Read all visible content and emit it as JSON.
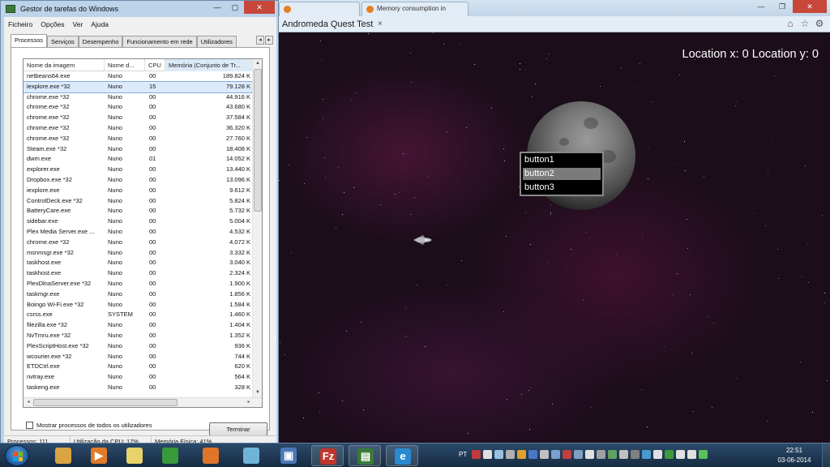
{
  "browser": {
    "tabs": [
      {
        "label": "",
        "icon": "page-icon"
      },
      {
        "label": "Memory consumption in",
        "icon": "page-icon"
      }
    ],
    "page_title": "Andromeda Quest Test",
    "tab_close": "×",
    "tools": [
      "home-icon",
      "star-icon",
      "gear-icon"
    ],
    "win_controls": {
      "minimize": "—",
      "maximize": "❐",
      "close": "✕"
    }
  },
  "game": {
    "location_text": "Location x: 0 Location y: 0",
    "menu_buttons": [
      {
        "label": "button1",
        "selected": false
      },
      {
        "label": "button2",
        "selected": true
      },
      {
        "label": "button3",
        "selected": false
      }
    ]
  },
  "taskmanager": {
    "title": "Gestor de tarefas do Windows",
    "win_controls": {
      "minimize": "—",
      "maximize": "▢",
      "close": "✕"
    },
    "menu": [
      "Ficheiro",
      "Opções",
      "Ver",
      "Ajuda"
    ],
    "tabs": [
      {
        "label": "Processos",
        "active": true
      },
      {
        "label": "Serviços",
        "active": false
      },
      {
        "label": "Desempenho",
        "active": false
      },
      {
        "label": "Funcionamento em rede",
        "active": false
      },
      {
        "label": "Utilizadores",
        "active": false
      }
    ],
    "tab_scroll": {
      "left": "◂",
      "right": "▸"
    },
    "columns": [
      "Nome da imagem",
      "Nome d...",
      "CPU",
      "Memória (Conjunto de Tr..."
    ],
    "sort_indicator": "˄",
    "processes": [
      {
        "name": "netbeans64.exe",
        "user": "Nuno",
        "cpu": "00",
        "mem": "189.824 K"
      },
      {
        "name": "iexplore.exe *32",
        "user": "Nuno",
        "cpu": "15",
        "mem": "79.128 K",
        "selected": true
      },
      {
        "name": "chrome.exe *32",
        "user": "Nuno",
        "cpu": "00",
        "mem": "44.916 K"
      },
      {
        "name": "chrome.exe *32",
        "user": "Nuno",
        "cpu": "00",
        "mem": "43.680 K"
      },
      {
        "name": "chrome.exe *32",
        "user": "Nuno",
        "cpu": "00",
        "mem": "37.584 K"
      },
      {
        "name": "chrome.exe *32",
        "user": "Nuno",
        "cpu": "00",
        "mem": "36.320 K"
      },
      {
        "name": "chrome.exe *32",
        "user": "Nuno",
        "cpu": "00",
        "mem": "27.760 K"
      },
      {
        "name": "Steam.exe *32",
        "user": "Nuno",
        "cpu": "00",
        "mem": "18.408 K"
      },
      {
        "name": "dwm.exe",
        "user": "Nuno",
        "cpu": "01",
        "mem": "14.052 K"
      },
      {
        "name": "explorer.exe",
        "user": "Nuno",
        "cpu": "00",
        "mem": "13.440 K"
      },
      {
        "name": "Dropbox.exe *32",
        "user": "Nuno",
        "cpu": "00",
        "mem": "13.096 K"
      },
      {
        "name": "iexplore.exe",
        "user": "Nuno",
        "cpu": "00",
        "mem": "9.612 K"
      },
      {
        "name": "ControlDeck.exe *32",
        "user": "Nuno",
        "cpu": "00",
        "mem": "5.824 K"
      },
      {
        "name": "BatteryCare.exe",
        "user": "Nuno",
        "cpu": "00",
        "mem": "5.732 K"
      },
      {
        "name": "sidebar.exe",
        "user": "Nuno",
        "cpu": "00",
        "mem": "5.004 K"
      },
      {
        "name": "Plex Media Server.exe ...",
        "user": "Nuno",
        "cpu": "00",
        "mem": "4.532 K"
      },
      {
        "name": "chrome.exe *32",
        "user": "Nuno",
        "cpu": "00",
        "mem": "4.072 K"
      },
      {
        "name": "msnmsgr.exe *32",
        "user": "Nuno",
        "cpu": "00",
        "mem": "3.332 K"
      },
      {
        "name": "taskhost.exe",
        "user": "Nuno",
        "cpu": "00",
        "mem": "3.040 K"
      },
      {
        "name": "taskhost.exe",
        "user": "Nuno",
        "cpu": "00",
        "mem": "2.324 K"
      },
      {
        "name": "PlexDlnaServer.exe *32",
        "user": "Nuno",
        "cpu": "00",
        "mem": "1.900 K"
      },
      {
        "name": "taskmgr.exe",
        "user": "Nuno",
        "cpu": "00",
        "mem": "1.856 K"
      },
      {
        "name": "Boingo Wi-Fi.exe *32",
        "user": "Nuno",
        "cpu": "00",
        "mem": "1.584 K"
      },
      {
        "name": "csrss.exe",
        "user": "SYSTEM",
        "cpu": "00",
        "mem": "1.460 K"
      },
      {
        "name": "filezilla.exe *32",
        "user": "Nuno",
        "cpu": "00",
        "mem": "1.404 K"
      },
      {
        "name": "NvTmru.exe *32",
        "user": "Nuno",
        "cpu": "00",
        "mem": "1.352 K"
      },
      {
        "name": "PlexScriptHost.exe *32",
        "user": "Nuno",
        "cpu": "00",
        "mem": "936 K"
      },
      {
        "name": "wcourier.exe *32",
        "user": "Nuno",
        "cpu": "00",
        "mem": "744 K"
      },
      {
        "name": "ETDCtrl.exe",
        "user": "Nuno",
        "cpu": "00",
        "mem": "620 K"
      },
      {
        "name": "nvtray.exe",
        "user": "Nuno",
        "cpu": "00",
        "mem": "564 K"
      },
      {
        "name": "taskeng.exe",
        "user": "Nuno",
        "cpu": "00",
        "mem": "328 K"
      }
    ],
    "scroll_arrows": {
      "up": "▲",
      "down": "▼",
      "left": "◂",
      "right": "▸"
    },
    "show_all_label": "Mostrar processos de todos os utilizadores",
    "end_button": "Terminar",
    "status": {
      "processes": "Processos: 111",
      "cpu": "Utilização da CPU: 17%",
      "memory": "Memória Física: 41%"
    }
  },
  "taskbar": {
    "pinned": [
      {
        "name": "explorer-icon",
        "glyph": "",
        "color": "#d9a441",
        "running": false
      },
      {
        "name": "media-player-icon",
        "glyph": "▶",
        "color": "#e07a2a",
        "running": false
      },
      {
        "name": "sticky-notes-icon",
        "glyph": "",
        "color": "#e8d36a",
        "running": false
      },
      {
        "name": "chrome-icon",
        "glyph": "",
        "color": "#3a9a3a",
        "running": false
      },
      {
        "name": "firefox-icon",
        "glyph": "",
        "color": "#e0742a",
        "running": false
      },
      {
        "name": "bird-icon",
        "glyph": "",
        "color": "#6fb4d8",
        "running": false
      },
      {
        "name": "virtualbox-icon",
        "glyph": "▣",
        "color": "#4a78b8",
        "running": false
      },
      {
        "name": "filezilla-icon",
        "glyph": "Fz",
        "color": "#c0362c",
        "running": true
      },
      {
        "name": "taskmanager-icon",
        "glyph": "▤",
        "color": "#3a7a3a",
        "running": true
      },
      {
        "name": "internet-explorer-icon",
        "glyph": "e",
        "color": "#2a8ad0",
        "running": true
      }
    ],
    "language": "PT",
    "tray_colors": [
      "#c03a3a",
      "#e0e0e0",
      "#9ac0e0",
      "#b0b0b0",
      "#e0a030",
      "#4a78c8",
      "#c0c0c0",
      "#7aa0d0",
      "#c04040",
      "#80a0c0",
      "#e0e0e0",
      "#a0a0a0",
      "#60a060",
      "#c0c0c0",
      "#808080",
      "#4a9ad0",
      "#e0e0e0",
      "#3c9c3c",
      "#e0e0e0",
      "#e0e0e0",
      "#5ac05a"
    ],
    "clock": {
      "time": "22:51",
      "date": "03-06-2014"
    }
  }
}
